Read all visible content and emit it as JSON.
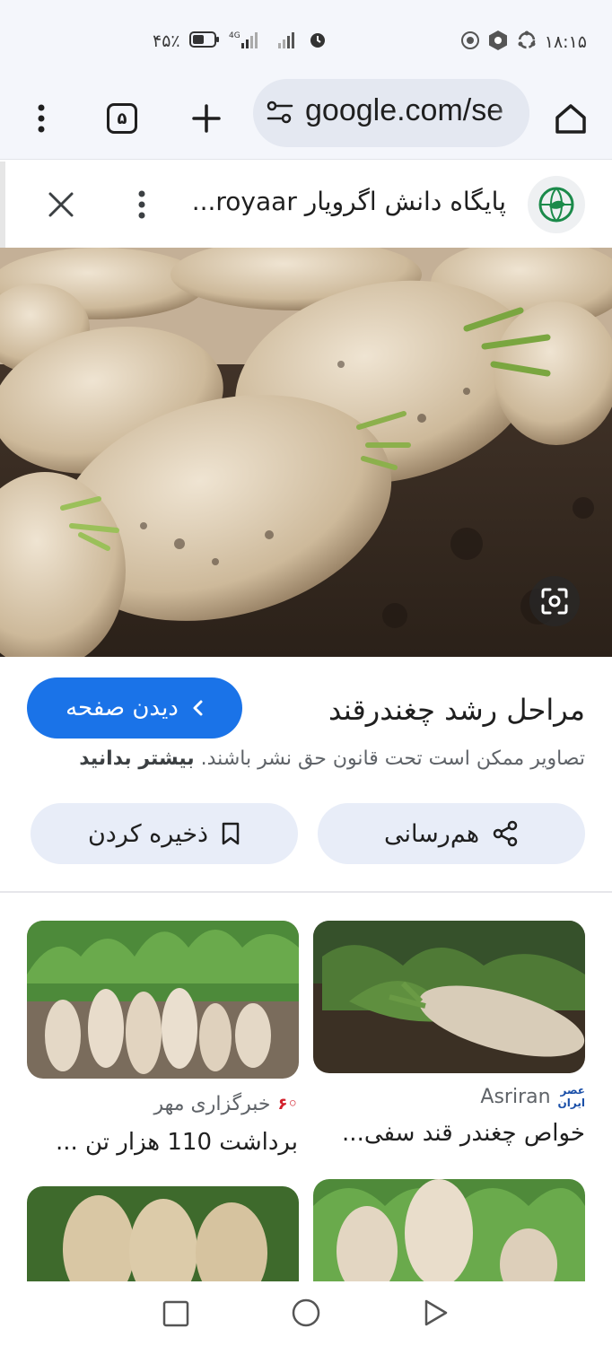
{
  "status_bar": {
    "time": "۱۸:۱۵",
    "battery": "۴۵٪",
    "network": "4G"
  },
  "toolbar": {
    "tab_count": "۵",
    "url": "google.com/se"
  },
  "panel": {
    "source_title": "پایگاه دانش اگرویار royaar...",
    "page_title": "مراحل رشد چغندرقند",
    "visit_label": "دیدن صفحه",
    "copyright_text": "تصاویر ممکن است تحت قانون حق نشر باشند.",
    "learn_more": "بیشتر بدانید",
    "share_label": "هم‌رسانی",
    "save_label": "ذخیره کردن"
  },
  "related": [
    {
      "source": "Asriran",
      "title": "خواص چغندر قند سفی..."
    },
    {
      "source": "خبرگزاری مهر",
      "title": "برداشت 110 هزار تن ..."
    }
  ],
  "colors": {
    "accent": "#1a73e8",
    "chip_bg": "#e8edf8",
    "toolbar_bg": "#f4f6fb"
  }
}
